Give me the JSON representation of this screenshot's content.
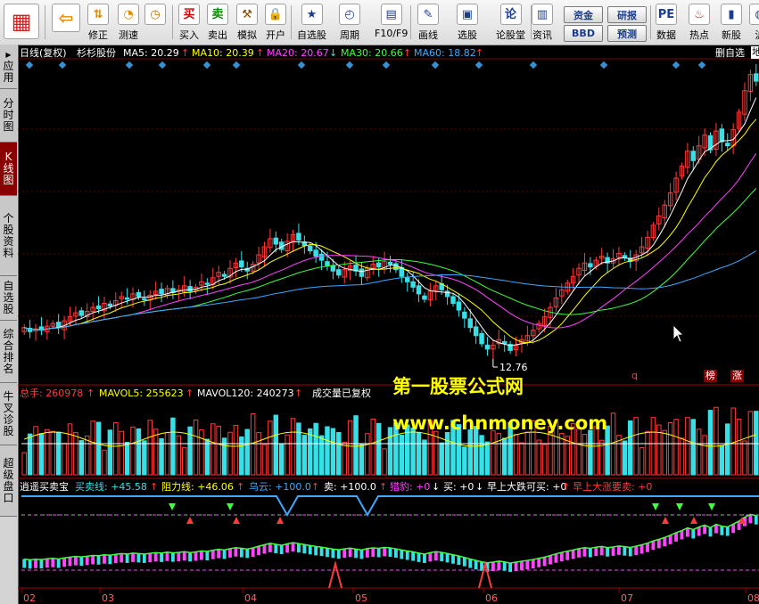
{
  "toolbar": {
    "buttons": [
      {
        "id": "logo",
        "label": "",
        "icon": "app-logo-icon"
      },
      {
        "id": "back",
        "label": "",
        "icon": "back-arrow-icon"
      },
      {
        "id": "xiuzheng",
        "label": "修正",
        "icon": "up-down-arrows-icon"
      },
      {
        "id": "cesu",
        "label": "测速",
        "icon": "speed-icon"
      },
      {
        "id": "clock",
        "label": "",
        "icon": "clock-icon"
      },
      {
        "id": "mairu",
        "label": "买入",
        "icon": "buy-icon",
        "glyph": "买"
      },
      {
        "id": "maichu",
        "label": "卖出",
        "icon": "sell-icon",
        "glyph": "卖"
      },
      {
        "id": "moni",
        "label": "模拟",
        "icon": "hammer-icon"
      },
      {
        "id": "kaihu",
        "label": "开户",
        "icon": "lock-icon"
      },
      {
        "id": "zixuangu",
        "label": "自选股",
        "icon": "star-folder-icon"
      },
      {
        "id": "zhouqi",
        "label": "周期",
        "icon": "period-icon"
      },
      {
        "id": "f10",
        "label": "F10/F9",
        "icon": "f10-icon"
      },
      {
        "id": "huaxian",
        "label": "画线",
        "icon": "pen-icon"
      },
      {
        "id": "xuangu",
        "label": "选股",
        "icon": "screen-icon"
      },
      {
        "id": "luntan",
        "label": "论股堂",
        "icon": "forum-icon",
        "glyph": "论"
      },
      {
        "id": "zixun",
        "label": "资讯",
        "icon": "news-icon"
      },
      {
        "id": "shuju",
        "label": "数据",
        "icon": "pe-icon"
      },
      {
        "id": "redian",
        "label": "热点",
        "icon": "hot-icon"
      },
      {
        "id": "xinxin",
        "label": "新股",
        "icon": "new-stock-icon"
      },
      {
        "id": "hu",
        "label": "沪",
        "icon": "globe-icon"
      }
    ],
    "small_buttons": {
      "zijin": "资金",
      "yanbao": "研报",
      "bbd": "BBD",
      "yuce": "预测"
    }
  },
  "sidebar": {
    "items": [
      {
        "label": "应用",
        "prefix": "▶"
      },
      {
        "label": "分时图"
      },
      {
        "label": "K线图",
        "active": true
      },
      {
        "label": "个股资料"
      },
      {
        "label": "自选股"
      },
      {
        "label": "综合排名"
      },
      {
        "label": "牛叉诊股"
      },
      {
        "label": "超级盘口"
      }
    ]
  },
  "main_header": {
    "period": "日线(复权)",
    "name": "杉杉股份",
    "ma5": "MA5: 20.29",
    "ma10": "MA10: 20.39",
    "ma20": "MA20: 20.67",
    "ma30": "MA30: 20.66",
    "ma60": "MA60: 18.82",
    "right_label": "删自选",
    "right_edge": "地"
  },
  "volume_header": {
    "total": "总手: 260978",
    "mavol5": "MAVOL5: 255623",
    "mavol120": "MAVOL120: 240273",
    "note": "成交量已复权"
  },
  "indicator_header": {
    "name": "逍遥买卖宝",
    "buy_line": "买卖线: +45.58",
    "resist": "阻力线: +46.06",
    "cloud": "乌云: +100.0",
    "sell": "卖: +100.0",
    "hunt": "猎豹: +0",
    "buy": "买: +0",
    "morning_drop": "早上大跌可买: +0",
    "morning_rise": "早上大涨要卖: +0"
  },
  "annotations": {
    "low_price": "12.76",
    "q": "q",
    "bang": "榜",
    "zhang": "涨"
  },
  "watermark": {
    "title": "第一股票公式网",
    "url": "www.chnmoney.com"
  },
  "x_axis": [
    "02",
    "03",
    "04",
    "05",
    "06",
    "07",
    "08"
  ],
  "colors": {
    "up": "#ff3b3b",
    "down": "#36e0e6",
    "ma5": "#ffffff",
    "ma10": "#ffff00",
    "ma20": "#ff44ff",
    "ma30": "#40ff40",
    "ma60": "#3fa9ff",
    "watermark": "#ffff00"
  },
  "chart_data": {
    "type": "candlestick",
    "x_labels": [
      "02",
      "03",
      "04",
      "05",
      "06",
      "07",
      "08"
    ],
    "low_marker": 12.76,
    "ma_values": {
      "MA5": 20.29,
      "MA10": 20.39,
      "MA20": 20.67,
      "MA30": 20.66,
      "MA60": 18.82
    },
    "volume": {
      "total": 260978,
      "mavol5": 255623,
      "mavol120": 240273
    },
    "close_series": [
      14.8,
      14.5,
      14.7,
      14.6,
      14.9,
      15.1,
      14.8,
      15.3,
      15.6,
      15.9,
      15.7,
      16.0,
      16.3,
      16.2,
      16.6,
      16.4,
      16.8,
      17.1,
      16.9,
      17.3,
      17.1,
      16.9,
      17.2,
      17.5,
      17.3,
      17.7,
      17.4,
      17.6,
      17.9,
      17.5,
      17.8,
      18.2,
      18.0,
      18.5,
      18.9,
      18.6,
      19.2,
      19.6,
      19.3,
      19.0,
      19.5,
      20.2,
      20.8,
      21.4,
      21.0,
      20.6,
      21.2,
      21.7,
      21.3,
      20.9,
      20.5,
      20.1,
      19.8,
      19.4,
      19.0,
      18.7,
      19.1,
      19.4,
      19.0,
      18.6,
      19.2,
      19.5,
      19.3,
      19.7,
      19.5,
      19.1,
      18.6,
      18.2,
      17.8,
      17.3,
      16.9,
      17.5,
      17.9,
      17.6,
      17.1,
      16.6,
      16.1,
      15.5,
      14.8,
      14.2,
      13.6,
      13.2,
      13.5,
      13.9,
      13.6,
      13.1,
      13.5,
      13.9,
      14.2,
      14.6,
      15.1,
      15.6,
      16.3,
      17.0,
      17.6,
      18.1,
      18.6,
      19.2,
      19.6,
      19.3,
      19.8,
      20.1,
      19.6,
      19.9,
      20.3,
      20.0,
      19.7,
      20.2,
      20.8,
      21.5,
      22.4,
      23.1,
      23.9,
      24.8,
      25.9,
      26.8,
      27.9,
      27.2,
      28.3,
      29.1,
      28.0,
      29.4,
      28.6,
      28.3,
      29.5,
      30.8,
      32.4,
      33.6,
      33.1
    ]
  }
}
